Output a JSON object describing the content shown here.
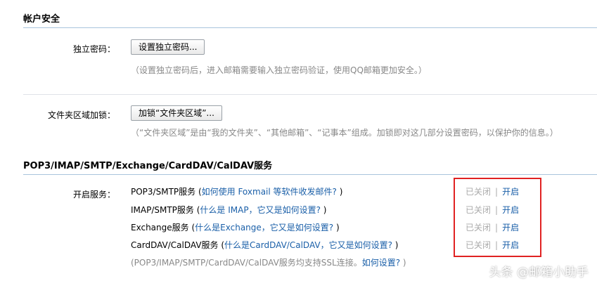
{
  "account_security": {
    "title": "帐户安全",
    "independent_password": {
      "label": "独立密码：",
      "button": "设置独立密码...",
      "hint": "（设置独立密码后，进入邮箱需要输入独立密码验证，使用QQ邮箱更加安全。）"
    },
    "folder_lock": {
      "label": "文件夹区域加锁：",
      "button": "加锁“文件夹区域”...",
      "hint": "（“文件夹区域”是由“我的文件夹”、“其他邮箱”、“记事本”组成。加锁即对这几部分设置密码，以保护你的信息。）"
    }
  },
  "services": {
    "title": "POP3/IMAP/SMTP/Exchange/CardDAV/CalDAV服务",
    "label": "开启服务：",
    "items": [
      {
        "name": "POP3/SMTP服务",
        "help_pre": " (",
        "help_link": "如何使用 Foxmail 等软件收发邮件?",
        "help_post": " )",
        "status_off": "已关闭",
        "sep": "|",
        "action": "开启"
      },
      {
        "name": "IMAP/SMTP服务",
        "help_pre": " (",
        "help_link": "什么是 IMAP，它又是如何设置?",
        "help_post": " )",
        "status_off": "已关闭",
        "sep": "|",
        "action": "开启"
      },
      {
        "name": "Exchange服务",
        "help_pre": " (",
        "help_link": "什么是Exchange，它又是如何设置?",
        "help_post": " )",
        "status_off": "已关闭",
        "sep": "|",
        "action": "开启"
      },
      {
        "name": "CardDAV/CalDAV服务",
        "help_pre": " (",
        "help_link": "什么是CardDAV/CalDAV，它又是如何设置?",
        "help_post": " )",
        "status_off": "已关闭",
        "sep": "|",
        "action": "开启"
      }
    ],
    "ssl_note": {
      "text": "(POP3/IMAP/SMTP/CardDAV/CalDAV服务均支持SSL连接。",
      "link": "如何设置?",
      "close": " )"
    }
  },
  "watermark": "头条 @邮箱小助手"
}
